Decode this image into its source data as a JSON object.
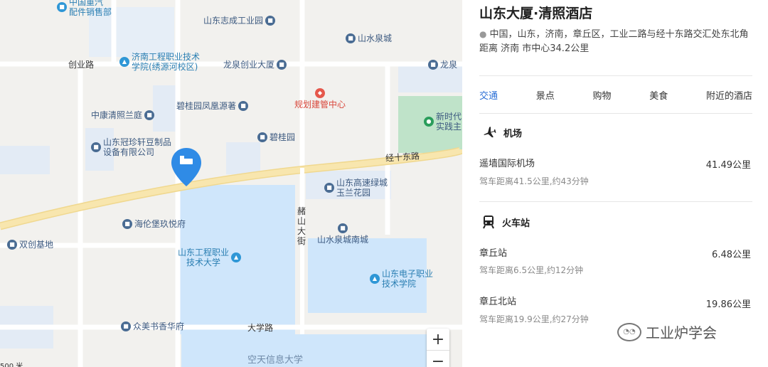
{
  "map": {
    "roads": {
      "chuangye": "创业路",
      "jingshi": "经十东路",
      "daxue": "大学路",
      "heshan": [
        "赭",
        "山",
        "大",
        "街"
      ]
    },
    "pois": [
      {
        "label": "中国重汽\n配件销售部",
        "icon": "building-icon",
        "style": "teal"
      },
      {
        "label": "山东志成工业园",
        "icon": "building-icon",
        "style": "blue"
      },
      {
        "label": "山水泉城",
        "icon": "building-icon",
        "style": "blue"
      },
      {
        "label": "济南工程职业技术\n学院(绣源河校区)",
        "icon": "school-icon",
        "style": "teal"
      },
      {
        "label": "龙泉创业大厦",
        "icon": "building-icon",
        "style": "blue"
      },
      {
        "label": "龙泉",
        "icon": "building-icon",
        "style": "blue"
      },
      {
        "label": "规划建管中心",
        "icon": "government-icon",
        "style": "red"
      },
      {
        "label": "中康清照兰庭",
        "icon": "building-icon",
        "style": "blue"
      },
      {
        "label": "碧桂园凤凰源著",
        "icon": "building-icon",
        "style": "blue"
      },
      {
        "label": "新时代\n实践主",
        "icon": "park-icon",
        "style": "green"
      },
      {
        "label": "山东冠珍轩豆制品\n设备有限公司",
        "icon": "building-icon",
        "style": "blue"
      },
      {
        "label": "碧桂园",
        "icon": "building-icon",
        "style": "blue"
      },
      {
        "label": "山东高速绿城\n玉兰花园",
        "icon": "building-icon",
        "style": "blue"
      },
      {
        "label": "海伦堡玖悦府",
        "icon": "building-icon",
        "style": "blue"
      },
      {
        "label": "山水泉城南城",
        "icon": "building-icon",
        "style": "blue"
      },
      {
        "label": "双创基地",
        "icon": "building-icon",
        "style": "blue"
      },
      {
        "label": "山东工程职业\n技术大学",
        "icon": "school-icon",
        "style": "teal"
      },
      {
        "label": "山东电子职业\n技术学院",
        "icon": "school-icon",
        "style": "teal"
      },
      {
        "label": "众美书香华府",
        "icon": "building-icon",
        "style": "blue"
      },
      {
        "label": "空天信息大学",
        "icon": "",
        "style": "blue"
      }
    ],
    "zoom_in": "+",
    "zoom_out": "−",
    "scale": "500 米",
    "marker_icon": "hotel-bed-icon"
  },
  "hotel": {
    "name": "山东大厦·清照酒店",
    "address": "中国，山东，济南，章丘区，工业二路与经十东路交汇处东北角 距离 济南 市中心34.2公里"
  },
  "tabs": [
    "交通",
    "景点",
    "购物",
    "美食",
    "附近的酒店"
  ],
  "active_tab": "交通",
  "airport": {
    "heading": "机场",
    "icon": "airplane-icon",
    "items": [
      {
        "name": "遥墙国际机场",
        "distance": "41.49公里",
        "detail": "驾车距离41.5公里,约43分钟"
      }
    ]
  },
  "train": {
    "heading": "火车站",
    "icon": "train-icon",
    "items": [
      {
        "name": "章丘站",
        "distance": "6.48公里",
        "detail": "驾车距离6.5公里,约12分钟"
      },
      {
        "name": "章丘北站",
        "distance": "19.86公里",
        "detail": "驾车距离19.9公里,约27分钟"
      }
    ]
  },
  "watermark": "工业炉学会",
  "colors": {
    "accent": "#2b6fd6",
    "marker": "#2f8be6",
    "road": "#f7e3a6",
    "campus": "#cfe6fb",
    "park": "#bfe3c9"
  }
}
